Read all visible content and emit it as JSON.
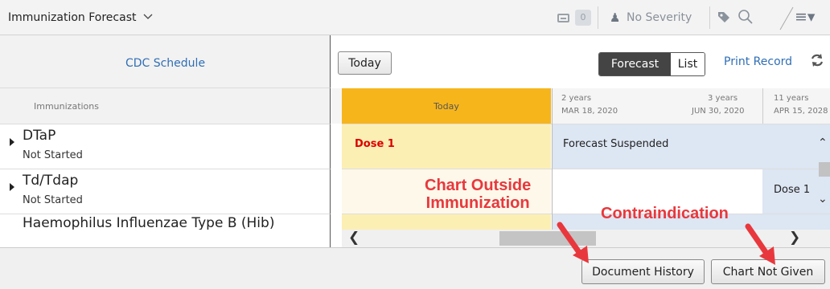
{
  "header": {
    "title": "Immunization Forecast",
    "inbox_count": "0",
    "severity_label": "No Severity"
  },
  "left_panel": {
    "schedule_link": "CDC Schedule",
    "column_header": "Immunizations",
    "rows": [
      {
        "name": "DTaP",
        "status": "Not Started"
      },
      {
        "name": "Td/Tdap",
        "status": "Not Started"
      },
      {
        "name": "Haemophilus Influenzae Type B (Hib)",
        "status": ""
      }
    ]
  },
  "toolbar": {
    "today_button": "Today",
    "forecast_toggle": "Forecast",
    "list_toggle": "List",
    "print_link": "Print Record"
  },
  "timeline": {
    "today_label": "Today",
    "ticks": [
      {
        "age": "2 years",
        "date": "MAR 18, 2020"
      },
      {
        "age": "3 years",
        "date": "JUN 30, 2020"
      },
      {
        "age": "11 years",
        "date": "APR 15, 2028"
      }
    ]
  },
  "grid": {
    "dtap_today": "Dose 1",
    "dtap_forecast": "Forecast Suspended",
    "tdtap_forecast": "Dose 1"
  },
  "footer": {
    "document_history": "Document History",
    "chart_not_given": "Chart Not Given"
  },
  "annotations": {
    "chart_outside_line1": "Chart Outside",
    "chart_outside_line2": "Immunization",
    "contraindication": "Contraindication"
  },
  "colors": {
    "today_column": "#f7b51c",
    "today_cell": "#fcefb4",
    "forecast_cell": "#dde6f3",
    "link": "#2f6eb5",
    "annotation": "#e8383d",
    "dose_alert": "#dd0000"
  },
  "icons": [
    "chevron-down-icon",
    "inbox-icon",
    "severity-icon",
    "tag-icon",
    "search-icon",
    "menu-icon",
    "refresh-icon",
    "expand-caret-icon",
    "scroll-left-icon",
    "scroll-right-icon",
    "scroll-up-icon",
    "scroll-down-icon"
  ]
}
